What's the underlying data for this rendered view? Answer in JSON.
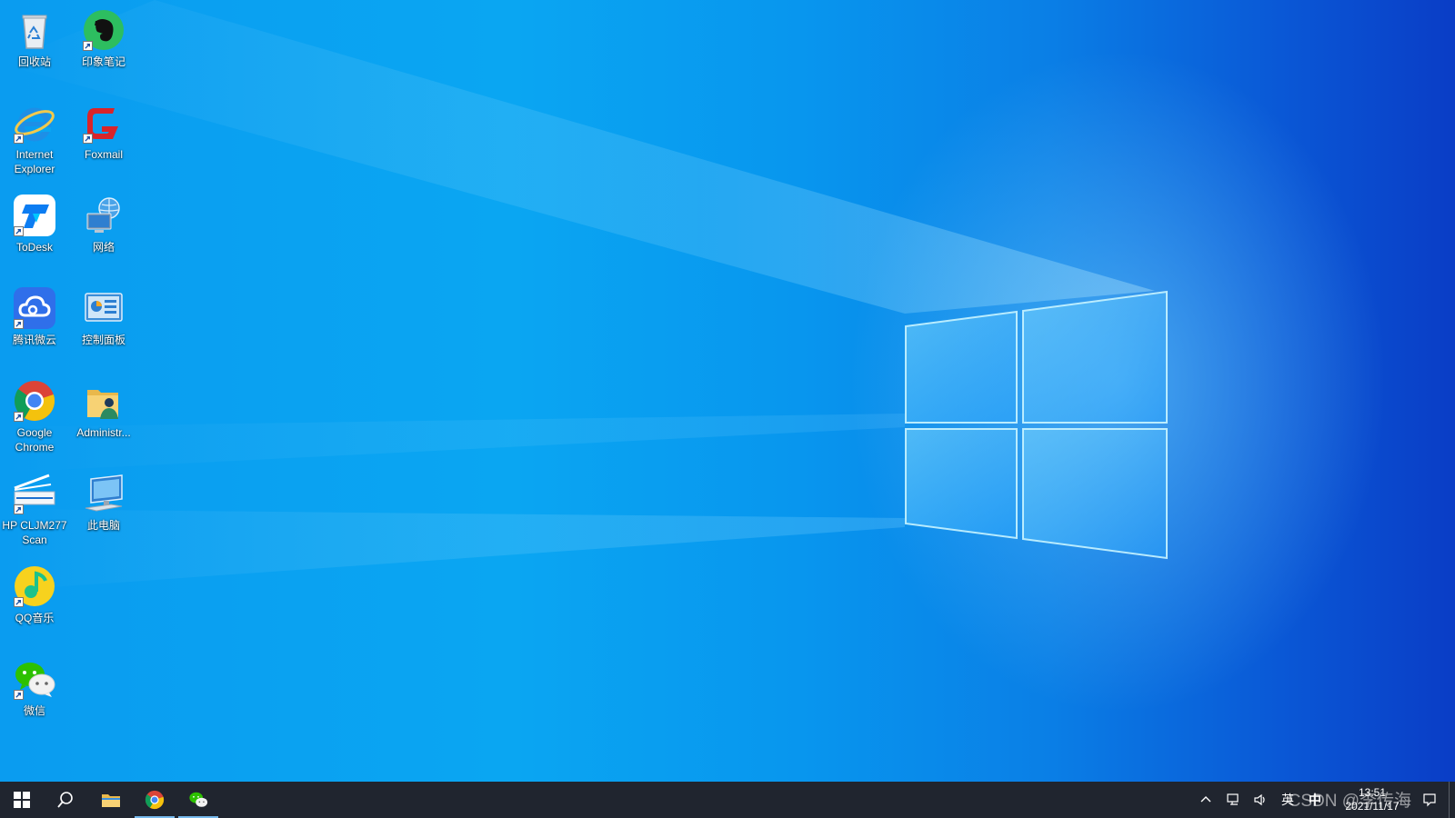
{
  "desktop": {
    "icons": [
      {
        "label": "回收站",
        "icon": "recycle-bin-icon",
        "shortcut": false
      },
      {
        "label": "印象笔记",
        "icon": "evernote-icon",
        "shortcut": true
      },
      {
        "label": "Internet Explorer",
        "icon": "internet-explorer-icon",
        "shortcut": true
      },
      {
        "label": "Foxmail",
        "icon": "foxmail-icon",
        "shortcut": true
      },
      {
        "label": "ToDesk",
        "icon": "todesk-icon",
        "shortcut": true
      },
      {
        "label": "网络",
        "icon": "network-icon",
        "shortcut": false
      },
      {
        "label": "腾讯微云",
        "icon": "tencent-weiyun-icon",
        "shortcut": true
      },
      {
        "label": "控制面板",
        "icon": "control-panel-icon",
        "shortcut": false
      },
      {
        "label": "Google Chrome",
        "icon": "chrome-icon",
        "shortcut": true
      },
      {
        "label": "Administr...",
        "icon": "user-folder-icon",
        "shortcut": false
      },
      {
        "label": "HP CLJM277 Scan",
        "icon": "scanner-icon",
        "shortcut": true
      },
      {
        "label": "此电脑",
        "icon": "this-pc-icon",
        "shortcut": false
      },
      {
        "label": "QQ音乐",
        "icon": "qq-music-icon",
        "shortcut": true
      },
      {
        "label": "微信",
        "icon": "wechat-icon",
        "shortcut": true
      }
    ]
  },
  "taskbar": {
    "buttons": [
      {
        "name": "start-button",
        "icon": "windows-icon"
      },
      {
        "name": "search-button",
        "icon": "search-icon"
      },
      {
        "name": "file-explorer-button",
        "icon": "folder-icon"
      },
      {
        "name": "chrome-taskbar-button",
        "icon": "chrome-icon",
        "active": true
      },
      {
        "name": "wechat-taskbar-button",
        "icon": "wechat-icon",
        "active": true
      }
    ],
    "tray": {
      "ime_language": "英",
      "ime_mode": "中",
      "time": "13:51",
      "date": "2021/11/17"
    }
  },
  "watermark": "CSDN @李传海",
  "colors": {
    "taskbar": "#20252f",
    "accent": "#76b9ed",
    "wallpaper_left": "#0aa6f2",
    "wallpaper_right": "#0a3dc6"
  }
}
